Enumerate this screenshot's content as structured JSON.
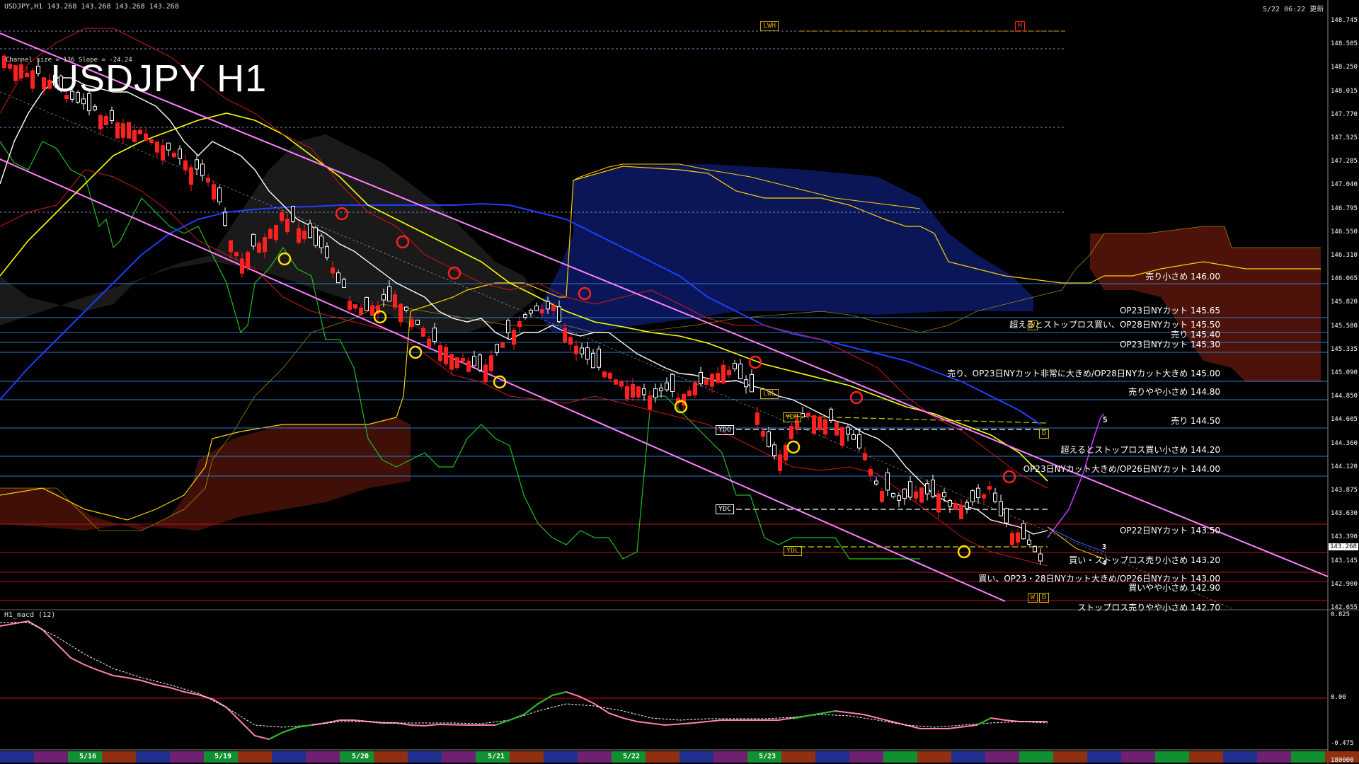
{
  "header": {
    "symbol_info": "USDJPY,H1  143.268 143.268 143.268 143.268",
    "update_time": "5/22 06:22 更新",
    "big_title": "USDJPY H1",
    "channel_info": "Channel size = 136 Slope = -24.24",
    "macd_label": "H1_macd (12)"
  },
  "price_axis": [
    "148.745",
    "148.505",
    "148.250",
    "148.015",
    "147.770",
    "147.525",
    "147.285",
    "147.040",
    "146.795",
    "146.550",
    "146.310",
    "146.065",
    "145.820",
    "145.580",
    "145.335",
    "145.090",
    "144.850",
    "144.605",
    "144.360",
    "144.120",
    "143.875",
    "143.630",
    "143.390",
    "143.145",
    "142.900",
    "142.655"
  ],
  "macd_axis": [
    "0.825",
    "0.00",
    "-0.475",
    "180000"
  ],
  "current_price": "143.268",
  "level_notes": [
    {
      "text": "売り小さめ 146.00"
    },
    {
      "text": "OP23日NYカット 145.65"
    },
    {
      "text": "超えるとストップロス買い、OP28日NYカット 145.50"
    },
    {
      "text": "売り 145.40"
    },
    {
      "text": "OP23日NYカット 145.30"
    },
    {
      "text": "売り、OP23日NYカット非常に大きめ/OP28日NYカット大きめ 145.00"
    },
    {
      "text": "売りやや小さめ 144.80"
    },
    {
      "text": "売り 144.50"
    },
    {
      "text": "超えるとストップロス買い小さめ 144.20"
    },
    {
      "text": "OP23日NYカット大きめ/OP26日NYカット 144.00"
    },
    {
      "text": "OP22日NYカット 143.50"
    },
    {
      "text": "買い・ストップロス売り小さめ 143.20"
    },
    {
      "text": "買い、OP23・28日NYカット大きめ/OP26日NYカット 143.00"
    },
    {
      "text": "買いやや小さめ 142.90"
    },
    {
      "text": "ストップロス売りやや小さめ 142.70"
    }
  ],
  "tags": {
    "lwh": "LWH",
    "m": "M",
    "lwl": "LWL",
    "ydh": "YDH",
    "ydo": "YDO",
    "ydc": "YDC",
    "ydl": "YDL",
    "d1": "D",
    "d2": "D",
    "w1": "W",
    "w2": "W",
    "wave5": "5",
    "wave3": "3",
    "wave4": "4"
  },
  "dates": [
    "5/16",
    "5/19",
    "5/20",
    "5/21",
    "5/22",
    "5/23"
  ],
  "colors": {
    "background": "#000000",
    "bull_candle": "#ffffff",
    "bear_candle": "#ff2020",
    "ma_short": "#ffffff",
    "ma_mid": "#ffff00",
    "ma_long": "#1f3fff",
    "channel": "#ff80ff",
    "chikou": "#1fbf1f",
    "kumo_bull": "#2040ff",
    "kumo_bear": "#ff4020",
    "level_blue": "#2c78d0",
    "level_red": "#cc1010"
  }
}
